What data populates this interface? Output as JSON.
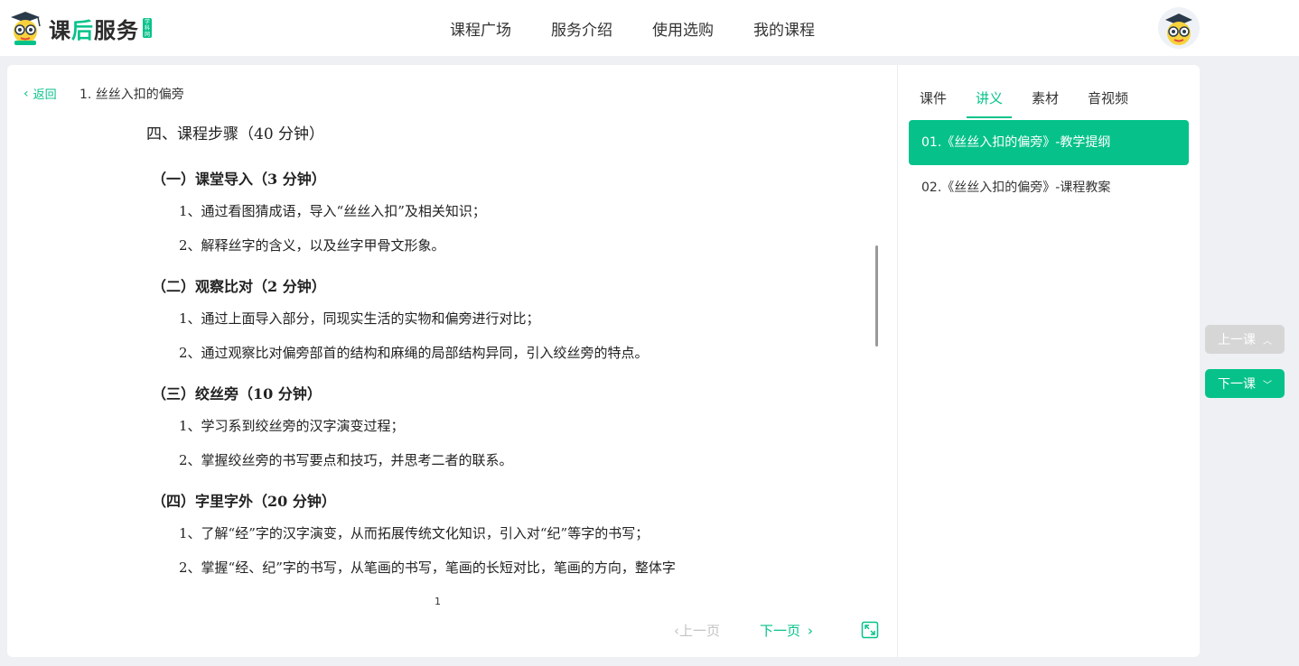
{
  "header": {
    "logo_text_a": "课",
    "logo_text_b": "后",
    "logo_text_c": "服务",
    "logo_badge": "学科网",
    "nav": [
      "课程广场",
      "服务介绍",
      "使用选购",
      "我的课程"
    ]
  },
  "main": {
    "back_label": "返回",
    "lesson_name": "1. 丝丝入扣的偏旁",
    "doc": {
      "title": "四、课程步骤（40 分钟）",
      "sections": [
        {
          "title": "（一）课堂导入（3 分钟）",
          "items": [
            "1、通过看图猜成语，导入“丝丝入扣”及相关知识；",
            "2、解释丝字的含义，以及丝字甲骨文形象。"
          ]
        },
        {
          "title": "（二）观察比对（2 分钟）",
          "items": [
            "1、通过上面导入部分，同现实生活的实物和偏旁进行对比；",
            "2、通过观察比对偏旁部首的结构和麻绳的局部结构异同，引入绞丝旁的特点。"
          ]
        },
        {
          "title": "（三）绞丝旁（10 分钟）",
          "items": [
            "1、学习系到绞丝旁的汉字演变过程；",
            "2、掌握绞丝旁的书写要点和技巧，并思考二者的联系。"
          ]
        },
        {
          "title": "（四）字里字外（20 分钟）",
          "items": [
            "1、了解“经”字的汉字演变，从而拓展传统文化知识，引入对“纪”等字的书写；",
            "2、掌握“经、纪”字的书写，从笔画的书写，笔画的长短对比，笔画的方向，整体字"
          ]
        }
      ]
    },
    "page_number": "1",
    "prev_page": "上一页",
    "next_page": "下一页"
  },
  "side": {
    "tabs": [
      "课件",
      "讲义",
      "素材",
      "音视频"
    ],
    "active_tab": 1,
    "items": [
      "01.《丝丝入扣的偏旁》-教学提纲",
      "02.《丝丝入扣的偏旁》-课程教案"
    ]
  },
  "float": {
    "prev_lesson": "上一课",
    "next_lesson": "下一课"
  },
  "colors": {
    "accent": "#06c28a",
    "disabled": "#d6d6d6"
  }
}
